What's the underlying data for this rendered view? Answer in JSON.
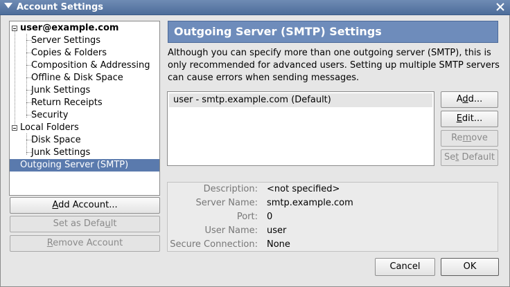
{
  "window": {
    "title": "Account Settings"
  },
  "tree": {
    "account": "user@example.com",
    "account_items": [
      "Server Settings",
      "Copies & Folders",
      "Composition & Addressing",
      "Offline & Disk Space",
      "Junk Settings",
      "Return Receipts",
      "Security"
    ],
    "local_folders": "Local Folders",
    "local_items": [
      "Disk Space",
      "Junk Settings"
    ],
    "outgoing": "Outgoing Server (SMTP)"
  },
  "left_buttons": {
    "add_account": {
      "pre": "",
      "key": "A",
      "post": "dd Account..."
    },
    "set_default": {
      "pre": "Set as Defa",
      "key": "u",
      "post": "lt"
    },
    "remove_account": {
      "pre": "",
      "key": "R",
      "post": "emove Account"
    }
  },
  "main": {
    "header": "Outgoing Server (SMTP) Settings",
    "description": "Although you can specify more than one outgoing server (SMTP), this is only recommended for advanced users. Setting up multiple SMTP servers can cause errors when sending messages.",
    "servers": [
      "user - smtp.example.com (Default)"
    ]
  },
  "side_buttons": {
    "add": {
      "pre": "A",
      "key": "d",
      "post": "d..."
    },
    "edit": {
      "pre": "",
      "key": "E",
      "post": "dit..."
    },
    "remove": {
      "pre": "Re",
      "key": "m",
      "post": "ove"
    },
    "set_default": {
      "pre": "Se",
      "key": "t",
      "post": " Default"
    }
  },
  "details": {
    "description_label": "Description:",
    "description_value": "<not specified>",
    "server_label": "Server Name:",
    "server_value": "smtp.example.com",
    "port_label": "Port:",
    "port_value": "0",
    "user_label": "User Name:",
    "user_value": "user",
    "secure_label": "Secure Connection:",
    "secure_value": "None"
  },
  "footer": {
    "cancel": "Cancel",
    "ok": "OK"
  },
  "colors": {
    "titlebar": "#5a7aad",
    "header": "#6e8cbb",
    "selection": "#5a7aad",
    "background": "#e6e6e6"
  }
}
